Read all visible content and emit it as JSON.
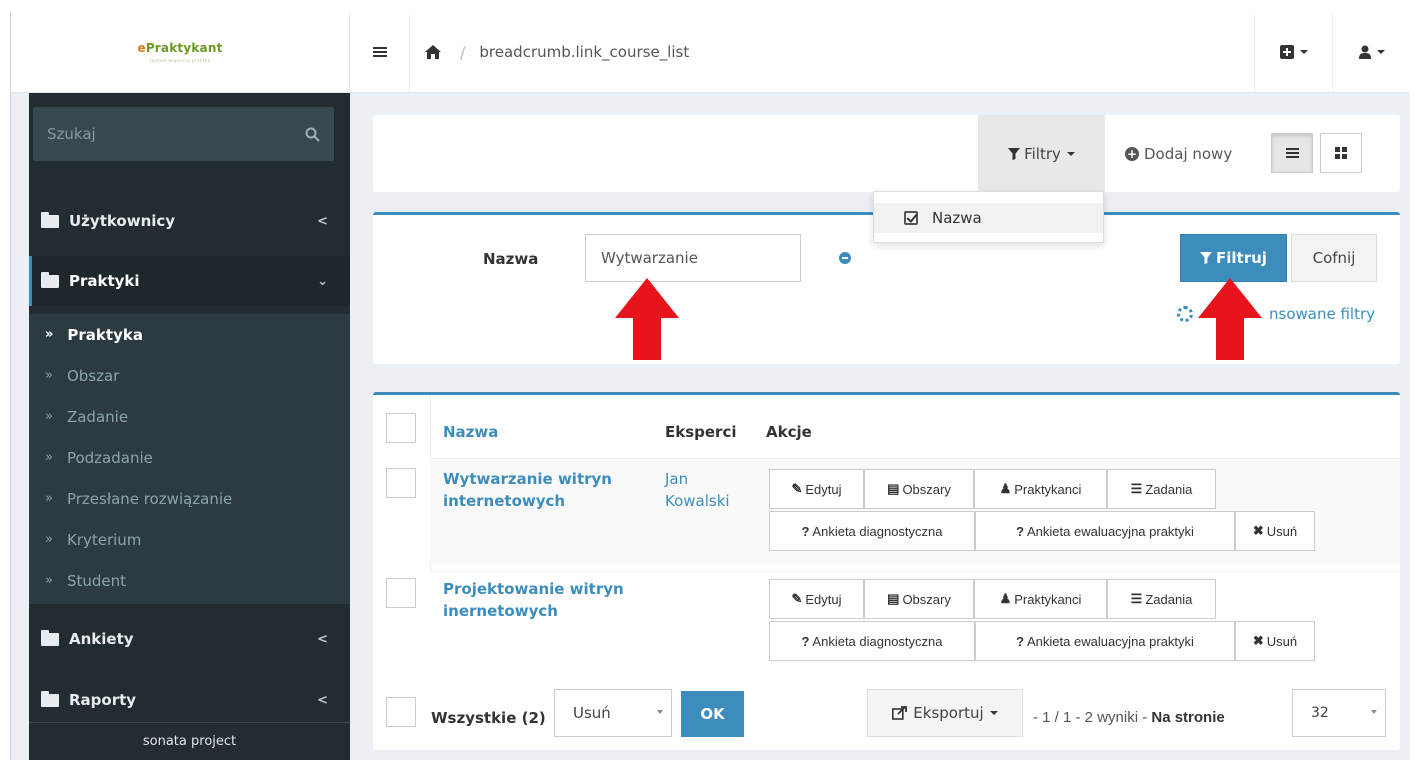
{
  "brand": {
    "name_prefix": "e",
    "name_rest": "Praktykant",
    "tagline": "system wsparcia praktyk"
  },
  "header": {
    "breadcrumb": "breadcrumb.link_course_list"
  },
  "sidebar": {
    "search_placeholder": "Szukaj",
    "items": [
      {
        "label": "Użytkownicy"
      },
      {
        "label": "Praktyki"
      },
      {
        "label": "Ankiety"
      },
      {
        "label": "Raporty"
      }
    ],
    "subitems": [
      {
        "label": "Praktyka"
      },
      {
        "label": "Obszar"
      },
      {
        "label": "Zadanie"
      },
      {
        "label": "Podzadanie"
      },
      {
        "label": "Przesłane rozwiązanie"
      },
      {
        "label": "Kryterium"
      },
      {
        "label": "Student"
      }
    ],
    "footer": "sonata project"
  },
  "toolbar": {
    "filters_label": "Filtry",
    "add_new_label": "Dodaj nowy"
  },
  "filters_dropdown": {
    "items": [
      {
        "label": "Nazwa"
      }
    ]
  },
  "filter_form": {
    "label": "Nazwa",
    "value": "Wytwarzanie",
    "filter_button": "Filtruj",
    "reset_button": "Cofnij",
    "advanced_link": "nsowane filtry"
  },
  "table": {
    "headers": {
      "name": "Nazwa",
      "experts": "Eksperci",
      "actions": "Akcje"
    },
    "rows": [
      {
        "name_l1": "Wytwarzanie witryn",
        "name_l2": "internetowych",
        "expert_l1": "Jan",
        "expert_l2": "Kowalski"
      },
      {
        "name_l1": "Projektowanie witryn",
        "name_l2": "inernetowych",
        "expert_l1": "",
        "expert_l2": ""
      }
    ],
    "actions": {
      "edit": "Edytuj",
      "areas": "Obszary",
      "interns": "Praktykanci",
      "tasks": "Zadania",
      "diag_survey": "Ankieta diagnostyczna",
      "eval_survey": "Ankieta ewaluacyjna praktyki",
      "delete": "Usuń"
    },
    "footer": {
      "all_label": "Wszystkie (2)",
      "batch_action": "Usuń",
      "ok": "OK",
      "export": "Eksportuj",
      "pager_prefix": "- 1 / 1 - 2 wyniki - ",
      "per_page_label": "Na stronie",
      "per_page_value": "32"
    }
  },
  "colors": {
    "accent": "#3c8dbc",
    "sidebar": "#222d32",
    "annotation_arrow": "#e8141b"
  }
}
